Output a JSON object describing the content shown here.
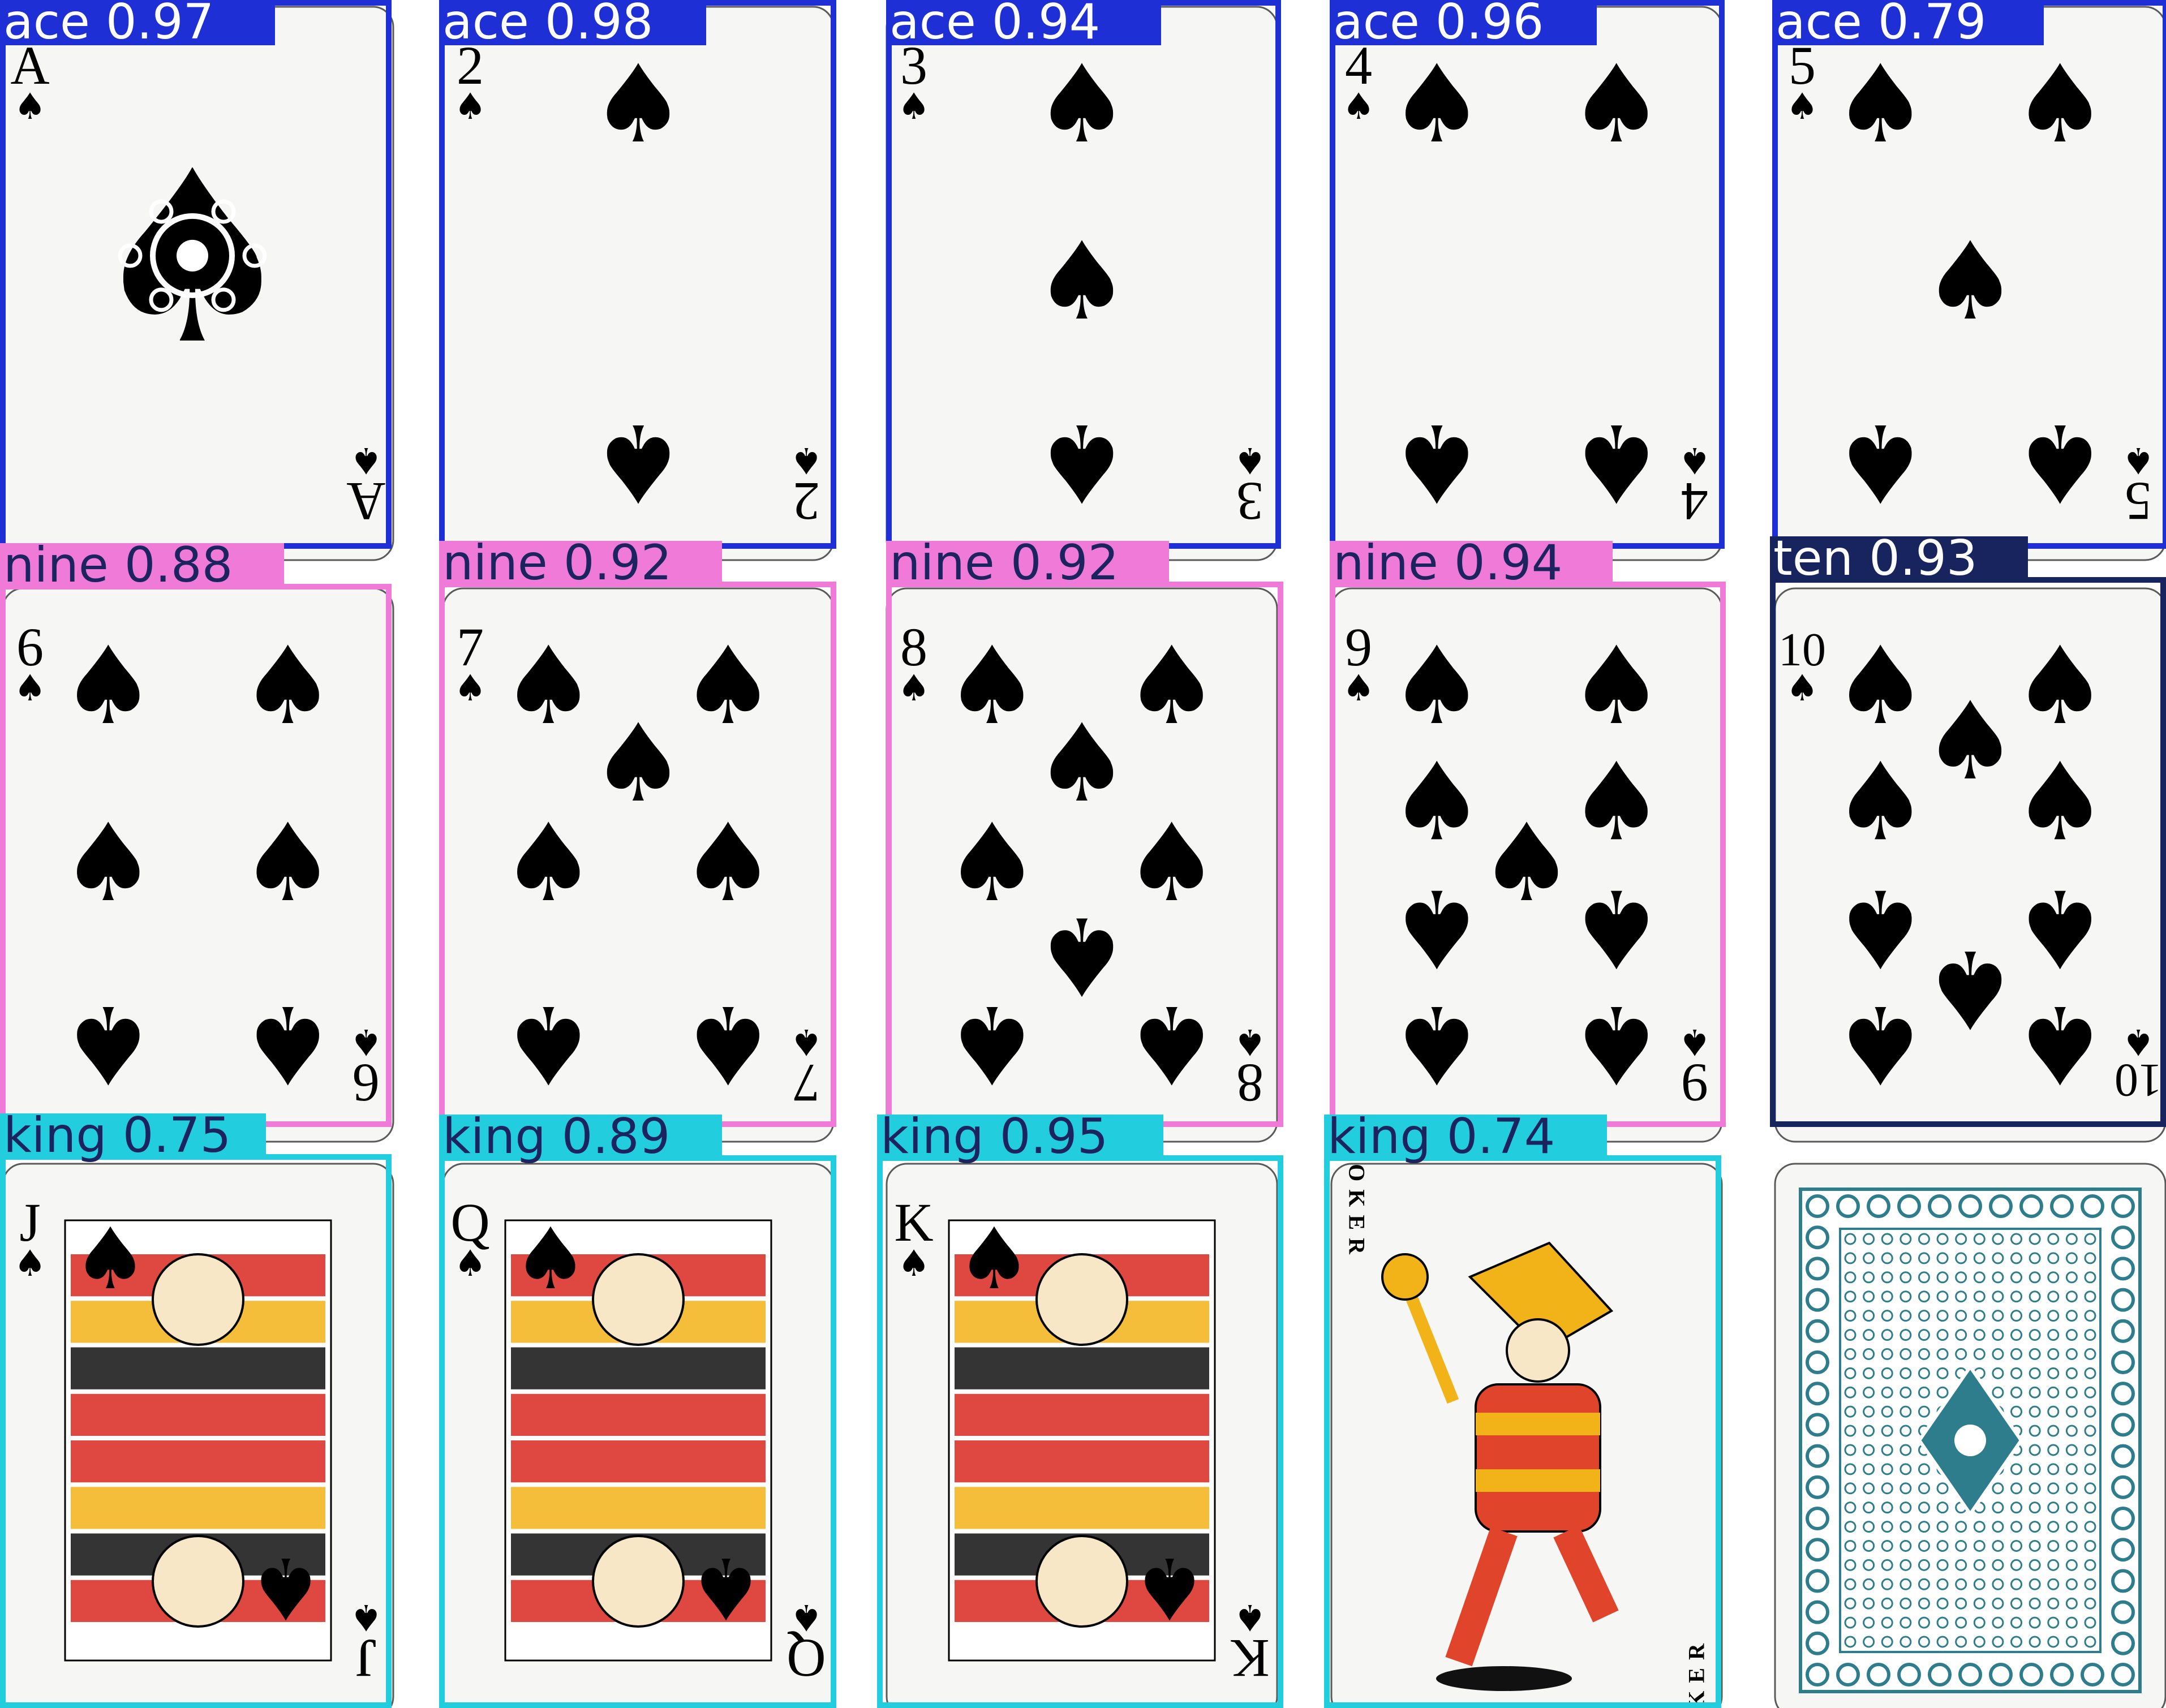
{
  "spade_glyph": "♠",
  "colors": {
    "label_text": "#ffffff",
    "label_text_dark": "#1c2460",
    "box_ace": "#1f2fd6",
    "box_nine": "#f07ad8",
    "box_ten": "#17245e",
    "box_king": "#22cedd",
    "card_face": "#f6f7f5",
    "card_edge": "#5a5a5a",
    "ink": "#000000",
    "card_back": "#2e7d8c"
  },
  "cards": [
    {
      "rank": "A",
      "suit": "spades",
      "kind": "ace-ornate"
    },
    {
      "rank": "2",
      "suit": "spades",
      "kind": "pips",
      "pip_count": 2
    },
    {
      "rank": "3",
      "suit": "spades",
      "kind": "pips",
      "pip_count": 3
    },
    {
      "rank": "4",
      "suit": "spades",
      "kind": "pips",
      "pip_count": 4
    },
    {
      "rank": "5",
      "suit": "spades",
      "kind": "pips",
      "pip_count": 5
    },
    {
      "rank": "6",
      "suit": "spades",
      "kind": "pips",
      "pip_count": 6
    },
    {
      "rank": "7",
      "suit": "spades",
      "kind": "pips",
      "pip_count": 7
    },
    {
      "rank": "8",
      "suit": "spades",
      "kind": "pips",
      "pip_count": 8
    },
    {
      "rank": "9",
      "suit": "spades",
      "kind": "pips",
      "pip_count": 9
    },
    {
      "rank": "10",
      "suit": "spades",
      "kind": "pips",
      "pip_count": 10
    },
    {
      "rank": "J",
      "suit": "spades",
      "kind": "face",
      "figure": "jack"
    },
    {
      "rank": "Q",
      "suit": "spades",
      "kind": "face",
      "figure": "queen"
    },
    {
      "rank": "K",
      "suit": "spades",
      "kind": "face",
      "figure": "king"
    },
    {
      "rank": "JOKER",
      "suit": "",
      "kind": "joker"
    },
    {
      "rank": "",
      "suit": "",
      "kind": "back"
    }
  ],
  "detections": [
    {
      "label": "ace",
      "confidence": "0.97",
      "color_key": "box_ace",
      "text_key": "label_text"
    },
    {
      "label": "ace",
      "confidence": "0.98",
      "color_key": "box_ace",
      "text_key": "label_text"
    },
    {
      "label": "ace",
      "confidence": "0.94",
      "color_key": "box_ace",
      "text_key": "label_text"
    },
    {
      "label": "ace",
      "confidence": "0.96",
      "color_key": "box_ace",
      "text_key": "label_text"
    },
    {
      "label": "ace",
      "confidence": "0.79",
      "color_key": "box_ace",
      "text_key": "label_text"
    },
    {
      "label": "nine",
      "confidence": "0.88",
      "color_key": "box_nine",
      "text_key": "label_text_dark"
    },
    {
      "label": "nine",
      "confidence": "0.92",
      "color_key": "box_nine",
      "text_key": "label_text_dark"
    },
    {
      "label": "nine",
      "confidence": "0.92",
      "color_key": "box_nine",
      "text_key": "label_text_dark"
    },
    {
      "label": "nine",
      "confidence": "0.94",
      "color_key": "box_nine",
      "text_key": "label_text_dark"
    },
    {
      "label": "ten",
      "confidence": "0.93",
      "color_key": "box_ten",
      "text_key": "label_text"
    },
    {
      "label": "king",
      "confidence": "0.75",
      "color_key": "box_king",
      "text_key": "label_text_dark"
    },
    {
      "label": "king",
      "confidence": "0.89",
      "color_key": "box_king",
      "text_key": "label_text_dark"
    },
    {
      "label": "king",
      "confidence": "0.95",
      "color_key": "box_king",
      "text_key": "label_text_dark"
    },
    {
      "label": "king",
      "confidence": "0.74",
      "color_key": "box_king",
      "text_key": "label_text_dark"
    }
  ]
}
